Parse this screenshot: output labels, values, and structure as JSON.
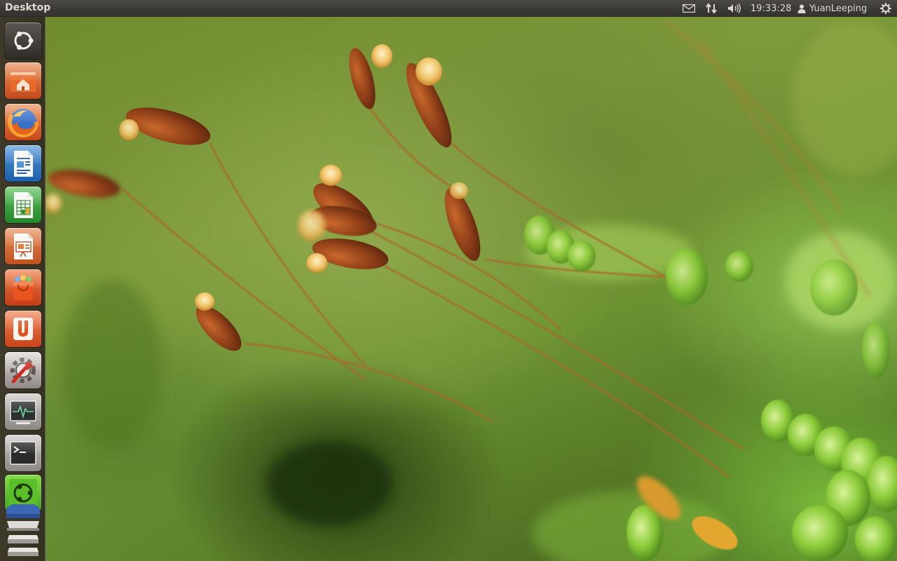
{
  "top_panel": {
    "window_title": "Desktop",
    "clock": "19:33:28",
    "user_name": "YuanLeeping",
    "indicators": [
      "mail-icon",
      "network-icon",
      "volume-icon",
      "session-gear-icon"
    ]
  },
  "launcher": {
    "items": [
      {
        "name": "dash-home-button",
        "icon": "ubuntu-logo-icon"
      },
      {
        "name": "home-folder-launcher",
        "icon": "home-folder-icon"
      },
      {
        "name": "firefox-launcher",
        "icon": "firefox-icon"
      },
      {
        "name": "libreoffice-writer-launcher",
        "icon": "writer-document-icon"
      },
      {
        "name": "libreoffice-calc-launcher",
        "icon": "calc-spreadsheet-icon"
      },
      {
        "name": "libreoffice-impress-launcher",
        "icon": "impress-presentation-icon"
      },
      {
        "name": "software-center-launcher",
        "icon": "software-center-bag-icon"
      },
      {
        "name": "ubuntu-one-launcher",
        "icon": "ubuntu-one-icon"
      },
      {
        "name": "system-settings-launcher",
        "icon": "settings-wrench-icon"
      },
      {
        "name": "system-monitor-launcher",
        "icon": "system-monitor-icon"
      },
      {
        "name": "terminal-launcher",
        "icon": "terminal-icon"
      },
      {
        "name": "workspace-switcher-launcher",
        "icon": "workspace-switcher-icon"
      },
      {
        "name": "storage-drive-launcher",
        "icon": "drive-stack-icon"
      }
    ]
  },
  "colors": {
    "panel_bg": "#3a3935",
    "panel_text": "#dfdbd2",
    "launcher_bg": "#3a3228"
  }
}
